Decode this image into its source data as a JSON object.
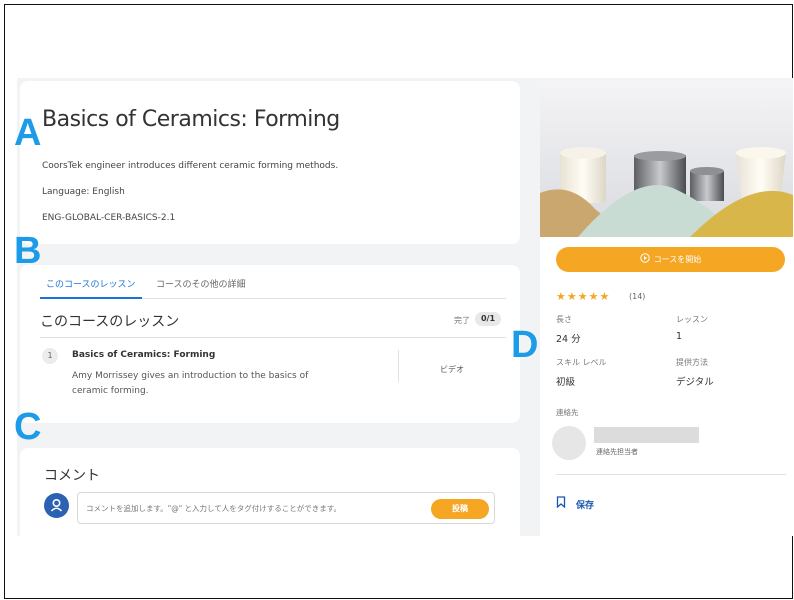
{
  "course": {
    "title": "Basics of Ceramics: Forming",
    "description": "CoorsTek engineer introduces different ceramic forming methods.",
    "language": "Language: English",
    "code": "ENG-GLOBAL-CER-BASICS-2.1"
  },
  "tabs": [
    "このコースのレッスン",
    "コースのその他の詳細"
  ],
  "lessons": {
    "section_title": "このコースのレッスン",
    "done_label": "完了",
    "done_count": "0/1",
    "items": [
      {
        "number": "1",
        "title": "Basics of Ceramics: Forming",
        "description": "Amy Morrissey gives an introduction to the basics of ceramic forming.",
        "type": "ビデオ"
      }
    ]
  },
  "comments": {
    "title": "コメント",
    "placeholder": "コメントを追加します。\"@\" と入力して人をタグ付けすることができます。",
    "post_label": "投稿"
  },
  "sidebar": {
    "start_label": "コースを開始",
    "stars": "★★★★★",
    "rating": 5,
    "rating_count": "(14)",
    "details": [
      {
        "label": "長さ",
        "value": "24 分"
      },
      {
        "label": "レッスン",
        "value": "1"
      },
      {
        "label": "スキル レベル",
        "value": "初級"
      },
      {
        "label": "提供方法",
        "value": "デジタル"
      }
    ],
    "contact_label": "連絡先",
    "contact_role": "連絡先担当者",
    "save_label": "保存"
  },
  "markers": [
    "A",
    "B",
    "C",
    "D"
  ],
  "colors": {
    "accent": "#f5a623",
    "link": "#1a73d9",
    "marker": "#1c9be8",
    "background": "#f2f3f5"
  }
}
